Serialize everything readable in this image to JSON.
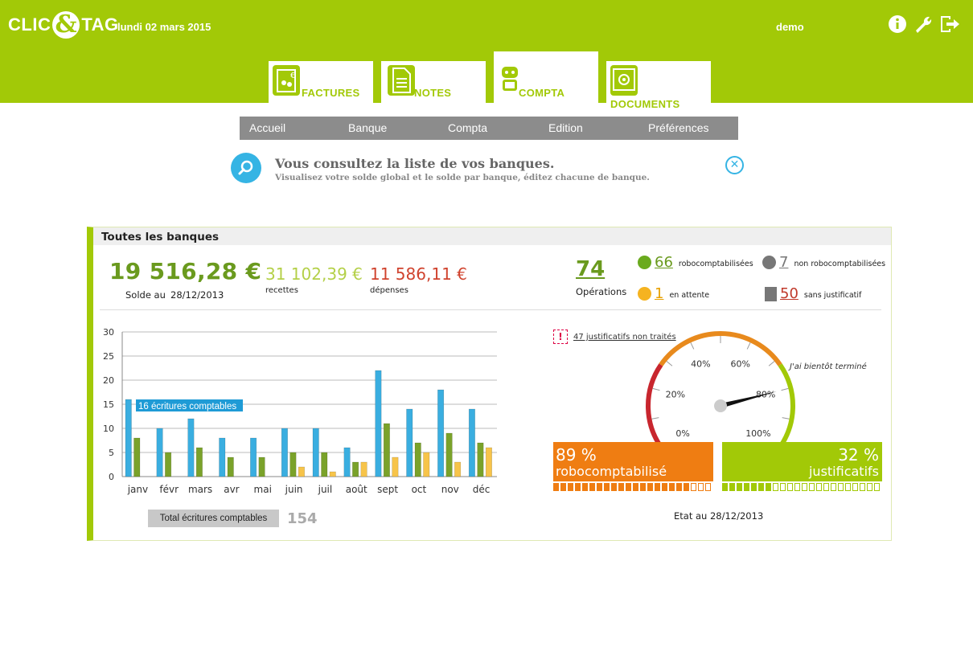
{
  "app": {
    "logo_left": "CLIC",
    "logo_amp": "&",
    "logo_right": "TAG",
    "date": "lundi 02 mars 2015",
    "user": "demo"
  },
  "tabs": [
    {
      "label": "FACTURES",
      "icon": "invoice-icon"
    },
    {
      "label": "NOTES",
      "icon": "notes-icon"
    },
    {
      "label": "COMPTA",
      "icon": "robot-icon"
    },
    {
      "label": "DOCUMENTS",
      "icon": "safe-icon"
    }
  ],
  "menu": [
    "Accueil",
    "Banque",
    "Compta",
    "Edition",
    "Préférences"
  ],
  "info": {
    "title": "Vous consultez la liste de vos banques.",
    "subtitle": "Visualisez votre solde global et le solde par banque, éditez chacune de banque.",
    "close": "✕"
  },
  "panel": {
    "title": "Toutes les banques",
    "balance": "19 516,28 €",
    "solde_label": "Solde au",
    "solde_date": "28/12/2013",
    "recettes": "31 102,39 €",
    "recettes_label": "recettes",
    "depenses": "11 586,11 €",
    "depenses_label": "dépenses",
    "operations": "74",
    "operations_label": "Opérations",
    "stats": {
      "robo": {
        "num": "66",
        "label": "robocomptabilisées",
        "color": "#6aaa1e"
      },
      "non_robo": {
        "num": "7",
        "label": "non robocomptabilisées",
        "color": "#777777"
      },
      "attente": {
        "num": "1",
        "label": "en attente",
        "color": "#f5b320"
      },
      "sans_just": {
        "num": "50",
        "label": "sans justificatif",
        "color": "#c0392b"
      }
    },
    "total_label": "Total écritures comptables",
    "total_value": "154",
    "warn_link": "47 justificatifs non traités",
    "gauge_note": "J'ai bientôt terminé",
    "robo_pct": "89 %",
    "robo_label": "robocomptabilisé",
    "robo_filled": 19,
    "robo_total": 22,
    "just_pct": "32 %",
    "just_label": "justificatifs",
    "just_filled": 7,
    "just_total": 22,
    "etat": "Etat au 28/12/2013"
  },
  "chart_data": {
    "type": "bar",
    "categories": [
      "janv",
      "févr",
      "mars",
      "avr",
      "mai",
      "juin",
      "juil",
      "août",
      "sept",
      "oct",
      "nov",
      "déc"
    ],
    "series": [
      {
        "values": [
          16,
          10,
          12,
          8,
          8,
          10,
          10,
          6,
          22,
          14,
          18,
          14
        ],
        "color": "#3aaee0"
      },
      {
        "values": [
          8,
          5,
          6,
          4,
          4,
          5,
          5,
          3,
          11,
          7,
          9,
          7
        ],
        "color": "#7aa22a"
      },
      {
        "values": [
          0,
          0,
          0,
          0,
          0,
          2,
          1,
          3,
          4,
          5,
          3,
          6
        ],
        "color": "#f7c44a"
      }
    ],
    "ylim": [
      0,
      30
    ],
    "yticks": [
      0,
      5,
      10,
      15,
      20,
      25,
      30
    ],
    "grid": true,
    "annotation": "16 écritures comptables"
  },
  "gauge_data": {
    "value": 80,
    "tick_labels": [
      "0%",
      "20%",
      "40%",
      "60%",
      "80%",
      "100%"
    ]
  }
}
